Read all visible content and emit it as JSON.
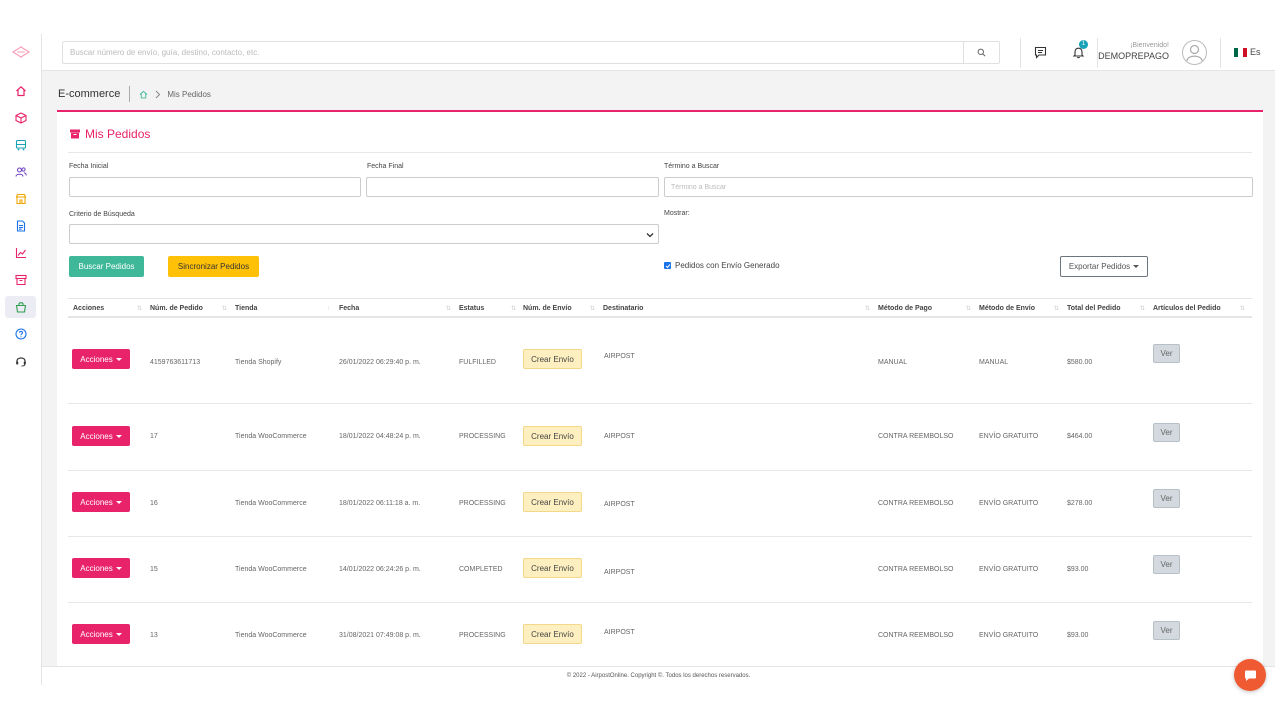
{
  "topbar": {
    "search_placeholder": "Buscar número de envío, guía, destino, contacto, etc.",
    "notification_count": "1",
    "welcome": "¡Bienvenido!",
    "username": "DEMOPREPAGO",
    "language": "Es"
  },
  "breadcrumb": {
    "section": "E-commerce",
    "current": "Mis Pedidos"
  },
  "page": {
    "title": "Mis Pedidos"
  },
  "filters": {
    "fecha_inicial_label": "Fecha Inicial",
    "fecha_final_label": "Fecha Final",
    "termino_label": "Término a Buscar",
    "termino_placeholder": "Término a Buscar",
    "criterio_label": "Criterio de Búsqueda",
    "mostrar_label": "Mostrar:",
    "checkbox_label": "Pedidos con Envío Generado"
  },
  "buttons": {
    "buscar": "Buscar Pedidos",
    "sincronizar": "Sincronizar Pedidos",
    "exportar": "Exportar Pedidos"
  },
  "table": {
    "headers": [
      "Acciones",
      "Núm. de Pedido",
      "Tienda",
      "Fecha",
      "Estatus",
      "Núm. de Envío",
      "Destinatario",
      "Método de Pago",
      "Método de Envío",
      "Total del Pedido",
      "Artículos del Pedido"
    ],
    "action_label": "Acciones",
    "crear_label": "Crear Envío",
    "ver_label": "Ver",
    "rows": [
      {
        "pedido": "4159763611713",
        "tienda": "Tienda Shopify",
        "fecha": "26/01/2022 06:29:40 p. m.",
        "estatus": "FULFILLED",
        "destinatario": "AIRPOST",
        "pago": "MANUAL",
        "envio": "MANUAL",
        "total": "$580.00"
      },
      {
        "pedido": "17",
        "tienda": "Tienda WooCommerce",
        "fecha": "18/01/2022 04:48:24 p. m.",
        "estatus": "PROCESSING",
        "destinatario": "AIRPOST",
        "pago": "CONTRA REEMBOLSO",
        "envio": "ENVÍO GRATUITO",
        "total": "$464.00"
      },
      {
        "pedido": "16",
        "tienda": "Tienda WooCommerce",
        "fecha": "18/01/2022 06:11:18 a. m.",
        "estatus": "PROCESSING",
        "destinatario": "AIRPOST",
        "pago": "CONTRA REEMBOLSO",
        "envio": "ENVÍO GRATUITO",
        "total": "$278.00"
      },
      {
        "pedido": "15",
        "tienda": "Tienda WooCommerce",
        "fecha": "14/01/2022 06:24:26 p. m.",
        "estatus": "COMPLETED",
        "destinatario": "AIRPOST",
        "pago": "CONTRA REEMBOLSO",
        "envio": "ENVÍO GRATUITO",
        "total": "$93.00"
      },
      {
        "pedido": "13",
        "tienda": "Tienda WooCommerce",
        "fecha": "31/08/2021 07:49:08 p. m.",
        "estatus": "PROCESSING",
        "destinatario": "AIRPOST",
        "pago": "CONTRA REEMBOLSO",
        "envio": "ENVÍO GRATUITO",
        "total": "$93.00"
      }
    ]
  },
  "footer": {
    "text": "© 2022 - AirpostOnline. Copyright ©. Todos los derechos reservados."
  },
  "colors": {
    "accent": "#e82369",
    "teal": "#3fb89a",
    "yellow": "#ffc107",
    "chat": "#f05a32"
  },
  "icons": {
    "sidebar": [
      "logo-icon",
      "home-icon",
      "box-icon",
      "truck-icon",
      "users-icon",
      "store-icon",
      "document-icon",
      "chart-icon",
      "archive-icon",
      "shopping-bag-icon",
      "help-icon",
      "headset-icon"
    ]
  }
}
